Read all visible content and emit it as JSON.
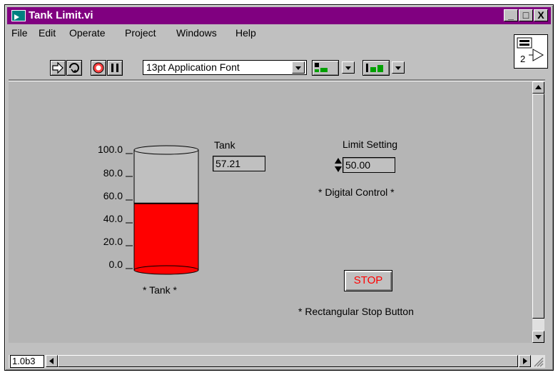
{
  "window": {
    "title": "Tank Limit.vi",
    "minimize": "_",
    "maximize": "□",
    "close": "X"
  },
  "menu": {
    "file": "File",
    "edit": "Edit",
    "operate": "Operate",
    "project": "Project",
    "windows": "Windows",
    "help": "Help"
  },
  "toolbar": {
    "font": "13pt Application Font",
    "vi_icon_number": "2"
  },
  "tank": {
    "scale": [
      "100.0",
      "80.0",
      "60.0",
      "40.0",
      "20.0",
      "0.0"
    ],
    "value": 57.21,
    "max": 100,
    "fill_color": "#ff0000",
    "caption": "* Tank *",
    "indicator_label": "Tank",
    "indicator_value": "57.21"
  },
  "limit": {
    "label": "Limit Setting",
    "value": "50.00",
    "caption": "* Digital Control *"
  },
  "stop": {
    "label": "STOP",
    "caption": "* Rectangular Stop Button"
  },
  "status": {
    "version": "1.0b3"
  }
}
